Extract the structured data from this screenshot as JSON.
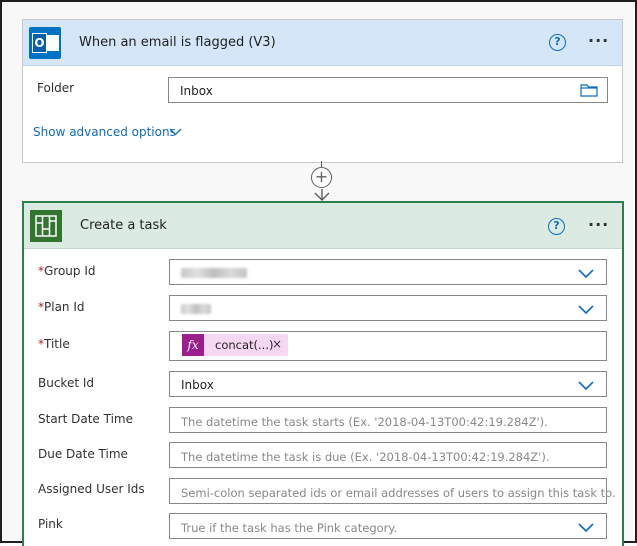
{
  "trigger": {
    "title": "When an email is flagged (V3)",
    "help_icon": "?",
    "more_icon": "···",
    "folder_label": "Folder",
    "folder_value": "Inbox",
    "advanced_link": "Show advanced options"
  },
  "connector": {
    "add_icon": "+"
  },
  "action": {
    "title": "Create a task",
    "help_icon": "?",
    "more_icon": "···",
    "required_mark": "*",
    "fields": {
      "group_id": {
        "label": "Group Id"
      },
      "plan_id": {
        "label": "Plan Id"
      },
      "title": {
        "label": "Title",
        "chip_icon": "fx",
        "chip_text": "concat(...)",
        "chip_remove": "×"
      },
      "bucket_id": {
        "label": "Bucket Id",
        "value": "Inbox"
      },
      "start_date": {
        "label": "Start Date Time",
        "placeholder": "The datetime the task starts (Ex. '2018-04-13T00:42:19.284Z')."
      },
      "due_date": {
        "label": "Due Date Time",
        "placeholder": "The datetime the task is due (Ex. '2018-04-13T00:42:19.284Z')."
      },
      "assigned": {
        "label": "Assigned User Ids",
        "placeholder": "Semi-colon separated ids or email addresses of users to assign this task to."
      },
      "pink": {
        "label": "Pink",
        "placeholder": "True if the task has the Pink category."
      }
    }
  },
  "colors": {
    "trigger_header": "#d4e6f7",
    "action_header": "#dcebe2",
    "action_border": "#2f7d4b",
    "link_blue": "#0f6cbd",
    "outlook_blue": "#0072c6",
    "planner_green": "#31752f",
    "expression_chip": "#f6d8f3",
    "expression_icon": "#9c1e8c"
  }
}
